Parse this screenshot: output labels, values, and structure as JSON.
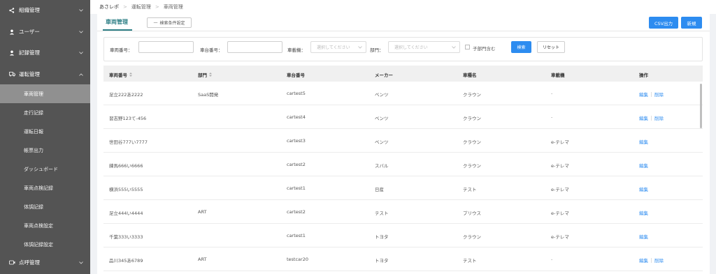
{
  "breadcrumb": [
    "あさレポ",
    "運転管理",
    "車両管理"
  ],
  "sidebar": {
    "groups": [
      {
        "label": "組織管理",
        "icon": "share-icon"
      },
      {
        "label": "ユーザー",
        "icon": "user-icon"
      },
      {
        "label": "記録管理",
        "icon": "user-icon"
      },
      {
        "label": "運転管理",
        "icon": "truck-icon"
      }
    ],
    "sub_items": [
      "車両管理",
      "走行記録",
      "運転日報",
      "帳票出力",
      "ダッシュボード",
      "車両点検記録",
      "体調記録",
      "車両点検設定",
      "体調記録設定"
    ],
    "last_group": {
      "label": "点呼管理",
      "icon": "camera-icon"
    }
  },
  "tabs": {
    "active": "車両管理"
  },
  "buttons": {
    "toggle_filter": "検索条件設定",
    "csv": "CSV出力",
    "new": "新規",
    "search": "検索",
    "reset": "リセット"
  },
  "filters": {
    "vehicle_no_label": "車両番号：",
    "car_no_label": "車台番号：",
    "device_label": "車載機：",
    "device_placeholder": "選択してください",
    "dept_label": "部門：",
    "dept_placeholder": "選択してください",
    "include_sub_label": "子部門含む"
  },
  "table": {
    "columns": [
      "車両番号",
      "部門",
      "車台番号",
      "メーカー",
      "車種名",
      "車載機",
      "操作"
    ],
    "edit_label": "編集",
    "delete_label": "削除",
    "rows": [
      {
        "vehicle": "足立222あ2222",
        "dept": "SaaS開発",
        "car": "cartest5",
        "maker": "ベンツ",
        "model": "クラウン",
        "device": "-",
        "delete": true
      },
      {
        "vehicle": "習志野123て-456",
        "dept": "",
        "car": "cartest4",
        "maker": "ベンツ",
        "model": "クラウン",
        "device": "-",
        "delete": true
      },
      {
        "vehicle": "世田谷777い7777",
        "dept": "",
        "car": "cartest3",
        "maker": "ベンツ",
        "model": "クラウン",
        "device": "e-テレマ",
        "delete": false
      },
      {
        "vehicle": "練馬666い6666",
        "dept": "",
        "car": "cartest2",
        "maker": "スバル",
        "model": "クラウン",
        "device": "e-テレマ",
        "delete": false
      },
      {
        "vehicle": "横浜555い5555",
        "dept": "",
        "car": "cartest1",
        "maker": "日産",
        "model": "テスト",
        "device": "e-テレマ",
        "delete": false
      },
      {
        "vehicle": "足立444い4444",
        "dept": "ART",
        "car": "cartest2",
        "maker": "テスト",
        "model": "プリウス",
        "device": "e-テレマ",
        "delete": false
      },
      {
        "vehicle": "千葉333い3333",
        "dept": "",
        "car": "cartest1",
        "maker": "トヨタ",
        "model": "クラウン",
        "device": "e-テレマ",
        "delete": false
      },
      {
        "vehicle": "品川345あ6789",
        "dept": "ART",
        "car": "testcar20",
        "maker": "トヨタ",
        "model": "テスト",
        "device": "-",
        "delete": true
      }
    ]
  }
}
